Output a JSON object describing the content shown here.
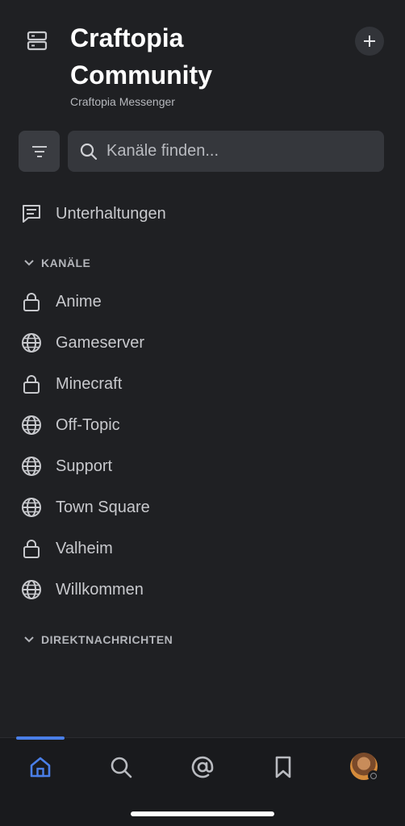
{
  "header": {
    "title": "Craftopia Community",
    "subtitle": "Craftopia Messenger",
    "server_icon": "server-icon",
    "add_icon": "plus-icon"
  },
  "filter": {
    "icon": "filter-icon"
  },
  "search": {
    "placeholder": "Kanäle finden...",
    "icon": "search-icon"
  },
  "threads": {
    "label": "Unterhaltungen",
    "icon": "message-icon"
  },
  "sections": {
    "channels": {
      "title": "KANÄLE",
      "items": [
        {
          "label": "Anime",
          "icon": "lock-icon"
        },
        {
          "label": "Gameserver",
          "icon": "globe-icon"
        },
        {
          "label": "Minecraft",
          "icon": "lock-icon"
        },
        {
          "label": "Off-Topic",
          "icon": "globe-icon"
        },
        {
          "label": "Support",
          "icon": "globe-icon"
        },
        {
          "label": "Town Square",
          "icon": "globe-icon"
        },
        {
          "label": "Valheim",
          "icon": "lock-icon"
        },
        {
          "label": "Willkommen",
          "icon": "globe-icon"
        }
      ]
    },
    "direct_messages": {
      "title": "DIREKTNACHRICHTEN"
    }
  },
  "bottom_nav": {
    "items": [
      "home-icon",
      "search-icon",
      "at-mention-icon",
      "bookmark-icon",
      "avatar"
    ],
    "active": "home-icon"
  },
  "colors": {
    "background": "#1f2023",
    "accent": "#4a7fe8",
    "text": "#c8c9cd"
  }
}
